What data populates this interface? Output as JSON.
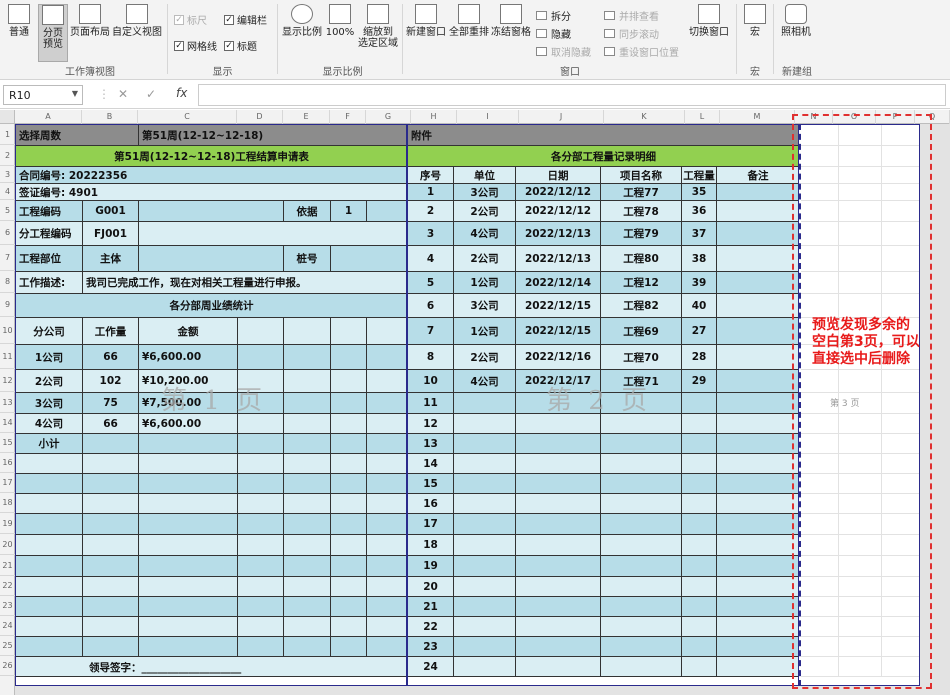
{
  "ribbon": {
    "group_views": {
      "label": "工作簿视图",
      "buttons": [
        "普通",
        "分页\n预览",
        "页面布局",
        "自定义视图"
      ]
    },
    "group_show": {
      "label": "显示",
      "checks": [
        {
          "label": "标尺",
          "checked": true,
          "disabled": true
        },
        {
          "label": "编辑栏",
          "checked": true,
          "disabled": false
        },
        {
          "label": "网格线",
          "checked": true,
          "disabled": false
        },
        {
          "label": "标题",
          "checked": true,
          "disabled": false
        }
      ]
    },
    "group_zoom": {
      "label": "显示比例",
      "buttons": [
        "显示比例",
        "100%",
        "缩放到\n选定区域"
      ]
    },
    "group_window": {
      "label": "窗口",
      "buttons": [
        "新建窗口",
        "全部重排",
        "冻结窗格"
      ],
      "small": [
        {
          "label": "拆分",
          "disabled": false
        },
        {
          "label": "隐藏",
          "disabled": false
        },
        {
          "label": "取消隐藏",
          "disabled": true
        },
        {
          "label": "并排查看",
          "disabled": true
        },
        {
          "label": "同步滚动",
          "disabled": true
        },
        {
          "label": "重设窗口位置",
          "disabled": true
        }
      ],
      "switch": "切换窗口"
    },
    "group_macro": {
      "label": "宏",
      "button": "宏"
    },
    "group_new": {
      "label": "新建组",
      "button": "照相机"
    }
  },
  "formula_bar": {
    "name_box": "R10",
    "fx": "fx",
    "value": ""
  },
  "columns": [
    {
      "id": "A",
      "w": 67
    },
    {
      "id": "B",
      "w": 56
    },
    {
      "id": "C",
      "w": 99
    },
    {
      "id": "D",
      "w": 46
    },
    {
      "id": "E",
      "w": 47
    },
    {
      "id": "F",
      "w": 36
    },
    {
      "id": "G",
      "w": 45
    },
    {
      "id": "H",
      "w": 46
    },
    {
      "id": "I",
      "w": 62
    },
    {
      "id": "J",
      "w": 85
    },
    {
      "id": "K",
      "w": 81
    },
    {
      "id": "L",
      "w": 35
    },
    {
      "id": "M",
      "w": 75
    },
    {
      "id": "N",
      "w": 38
    },
    {
      "id": "O",
      "w": 43
    },
    {
      "id": "P",
      "w": 39
    },
    {
      "id": "Q",
      "w": 35
    }
  ],
  "rows": [
    "1",
    "2",
    "3",
    "4",
    "5",
    "6",
    "7",
    "8",
    "9",
    "10",
    "11",
    "12",
    "13",
    "14",
    "15",
    "16",
    "17",
    "18",
    "19",
    "20",
    "21",
    "22",
    "23",
    "24",
    "25",
    "26"
  ],
  "page1": {
    "header_left": "选择周数",
    "header_week": "第51周(12-12~12-18)",
    "title": "第51周(12-12~12-18)工程结算申请表",
    "contract_label": "合同编号:",
    "contract_value": "20222356",
    "visa_label": "签证编号:",
    "visa_value": "4901",
    "project_code_label": "工程编码",
    "project_code_value": "G001",
    "basis_label": "依据",
    "basis_value": "1",
    "sub_code_label": "分工程编码",
    "sub_code_value": "FJ001",
    "dept_label": "工程部位",
    "dept_value": "主体",
    "pile_label": "桩号",
    "desc_label": "工作描述:",
    "desc_value": "我司已完成工作，现在对相关工程量进行申报。",
    "stats_title": "各分部周业绩统计",
    "stats_headers": [
      "分公司",
      "工作量",
      "金额"
    ],
    "stats_rows": [
      [
        "1公司",
        "66",
        "¥6,600.00"
      ],
      [
        "2公司",
        "102",
        "¥10,200.00"
      ],
      [
        "3公司",
        "75",
        "¥7,500.00"
      ],
      [
        "4公司",
        "66",
        "¥6,600.00"
      ]
    ],
    "subtotal_label": "小计",
    "sign_label": "领导签字：___________________",
    "watermark": "第 1 页"
  },
  "page2": {
    "header": "附件",
    "title": "各分部工程量记录明细",
    "headers": [
      "序号",
      "单位",
      "日期",
      "项目名称",
      "工程量",
      "备注"
    ],
    "rows": [
      [
        "1",
        "3公司",
        "2022/12/12",
        "工程77",
        "35",
        ""
      ],
      [
        "2",
        "2公司",
        "2022/12/12",
        "工程78",
        "36",
        ""
      ],
      [
        "3",
        "4公司",
        "2022/12/13",
        "工程79",
        "37",
        ""
      ],
      [
        "4",
        "2公司",
        "2022/12/13",
        "工程80",
        "38",
        ""
      ],
      [
        "5",
        "1公司",
        "2022/12/14",
        "工程12",
        "39",
        ""
      ],
      [
        "6",
        "3公司",
        "2022/12/15",
        "工程82",
        "40",
        ""
      ],
      [
        "7",
        "1公司",
        "2022/12/15",
        "工程69",
        "27",
        ""
      ],
      [
        "8",
        "2公司",
        "2022/12/16",
        "工程70",
        "28",
        ""
      ],
      [
        "10",
        "4公司",
        "2022/12/17",
        "工程71",
        "29",
        ""
      ]
    ],
    "empty_numbers": [
      "11",
      "12",
      "13",
      "14",
      "15",
      "16",
      "17",
      "18",
      "19",
      "20",
      "21",
      "22",
      "23",
      "24"
    ],
    "watermark": "第 2 页"
  },
  "page3": {
    "watermark": "第 3 页"
  },
  "annotation": {
    "text": "预览发现多余的空白第3页，可以直接选中后删除",
    "color": "#e81b1b"
  },
  "colors": {
    "header_gray": "#8c8c8c",
    "title_green": "#92d050",
    "cell_blue": "#b7dde8",
    "cell_light": "#daeef3",
    "page_border": "#2a2a8c"
  }
}
